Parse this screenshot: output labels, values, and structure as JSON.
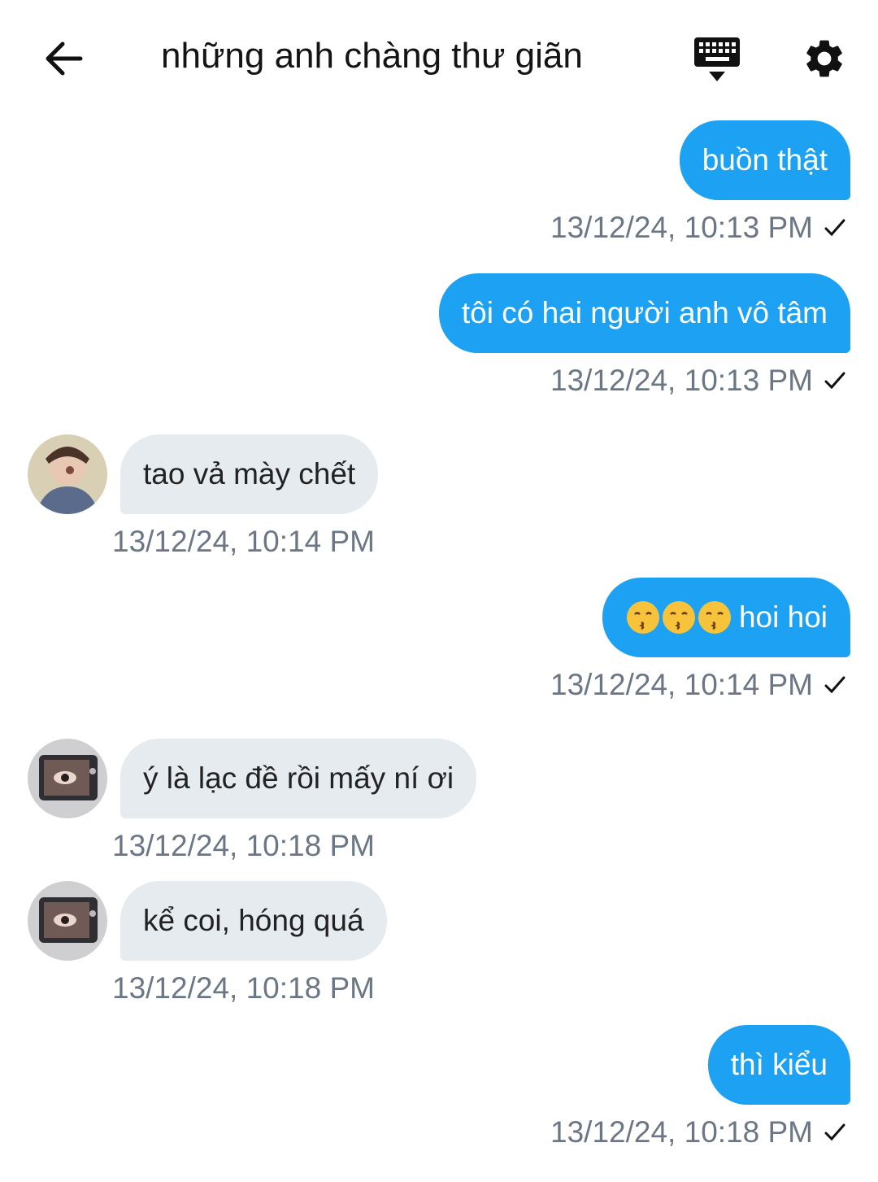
{
  "header": {
    "title": "những anh chàng thư giãn"
  },
  "messages": [
    {
      "text": "buồn thật",
      "time": "13/12/24, 10:13 PM"
    },
    {
      "text": "tôi có hai người anh vô tâm",
      "time": "13/12/24, 10:13 PM"
    },
    {
      "text": "tao vả mày chết",
      "time": "13/12/24, 10:14 PM"
    },
    {
      "text": "hoi hoi",
      "time": "13/12/24, 10:14 PM",
      "emoji": "😙😙😙"
    },
    {
      "text": "ý là lạc đề rồi mấy ní ơi",
      "time": "13/12/24, 10:18 PM"
    },
    {
      "text": "kể coi, hóng quá",
      "time": "13/12/24, 10:18 PM"
    },
    {
      "text": "thì kiểu",
      "time": "13/12/24, 10:18 PM"
    }
  ],
  "colors": {
    "outgoing_bubble": "#1da1f2",
    "incoming_bubble": "#e6ebef",
    "timestamp": "#6b7785"
  },
  "icons": {
    "back": "arrow-left-icon",
    "keyboard": "keyboard-icon",
    "settings": "gear-icon",
    "delivered": "checkmark-icon"
  }
}
